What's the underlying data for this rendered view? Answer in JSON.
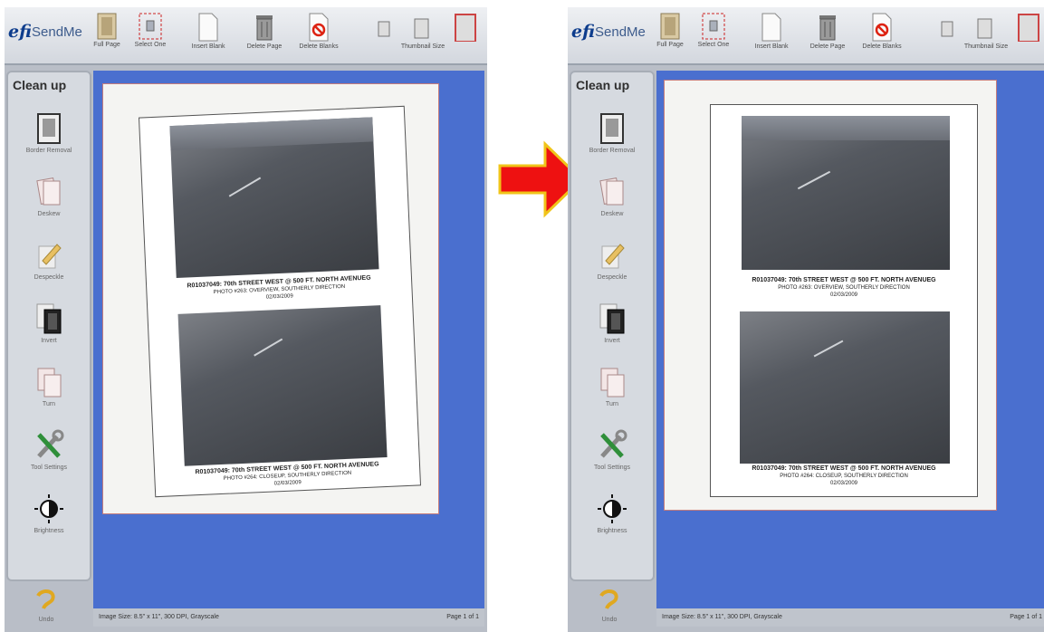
{
  "screens": {
    "logo": "efi",
    "app_name": "SendMe",
    "toolbar": {
      "full_page": "Full Page",
      "select_one": "Select One",
      "insert_blank": "Insert Blank",
      "delete_page": "Delete Page",
      "delete_blanks": "Delete Blanks",
      "thumbnail_size": "Thumbnail Size"
    },
    "sidebar": {
      "title": "Clean up",
      "border_removal": "Border Removal",
      "deskew": "Deskew",
      "despeckle": "Despeckle",
      "invert": "Invert",
      "turn": "Turn",
      "tool_settings": "Tool Settings",
      "brightness": "Brightness"
    },
    "undo": "Undo",
    "status": {
      "image_size": "Image Size: 8.5\" x 11\", 300 DPI, Grayscale",
      "page": "Page 1 of 1"
    },
    "document": {
      "caption1_title": "R01037049: 70th STREET WEST @ 500 FT. NORTH AVENUEG",
      "caption1_line2": "PHOTO #263: OVERVIEW, SOUTHERLY DIRECTION",
      "caption1_date": "02/03/2009",
      "caption2_title": "R01037049: 70th STREET WEST @ 500 FT. NORTH AVENUEG",
      "caption2_line2": "PHOTO #264: CLOSEUP, SOUTHERLY DIRECTION",
      "caption2_date": "02/03/2009"
    }
  },
  "colors": {
    "canvas_blue": "#4a6fcf",
    "arrow_red": "#ee1111",
    "arrow_outline": "#f0c419"
  }
}
